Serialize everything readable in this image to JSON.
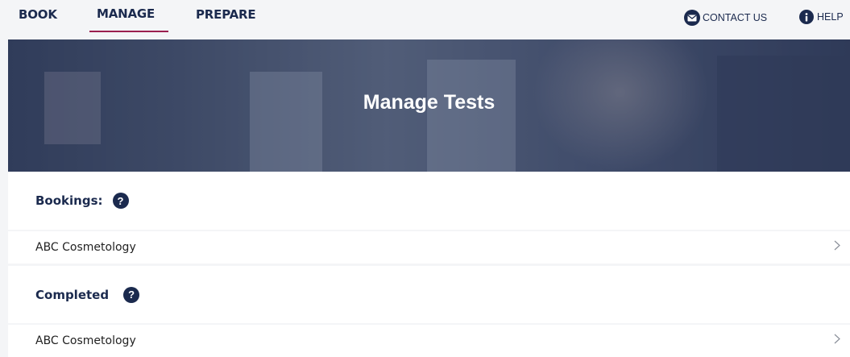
{
  "nav": {
    "tabs": [
      {
        "label": "BOOK"
      },
      {
        "label": "MANAGE",
        "active": true
      },
      {
        "label": "PREPARE"
      }
    ],
    "contact_label": "CONTACT US",
    "help_label": "HELP"
  },
  "hero": {
    "title": "Manage Tests"
  },
  "sections": {
    "bookings": {
      "title": "Bookings:",
      "items": [
        {
          "label": "ABC Cosmetology"
        }
      ]
    },
    "completed": {
      "title": "Completed",
      "items": [
        {
          "label": "ABC Cosmetology"
        }
      ]
    }
  },
  "colors": {
    "navy": "#1b2a4e",
    "accent": "#9b1f4f",
    "background": "#f4f5f7",
    "card": "#ffffff"
  },
  "icons": [
    "envelope-icon",
    "info-icon",
    "question-icon",
    "chevron-right-icon"
  ]
}
